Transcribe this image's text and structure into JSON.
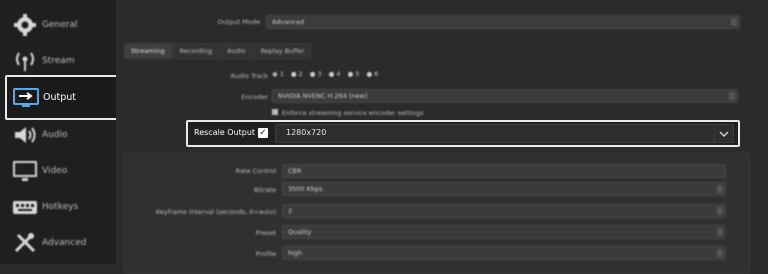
{
  "sidebar": {
    "items": [
      {
        "label": "General",
        "icon": "gear-icon"
      },
      {
        "label": "Stream",
        "icon": "broadcast-icon"
      },
      {
        "label": "Output",
        "icon": "output-monitor-icon"
      },
      {
        "label": "Audio",
        "icon": "speaker-icon"
      },
      {
        "label": "Video",
        "icon": "monitor-icon"
      },
      {
        "label": "Hotkeys",
        "icon": "keyboard-icon"
      },
      {
        "label": "Advanced",
        "icon": "tools-icon"
      }
    ]
  },
  "main": {
    "output_mode": {
      "label": "Output Mode",
      "value": "Advanced"
    },
    "tabs": [
      "Streaming",
      "Recording",
      "Audio",
      "Replay Buffer"
    ],
    "audio_track": {
      "label": "Audio Track",
      "options": [
        "1",
        "2",
        "3",
        "4",
        "5",
        "6"
      ]
    },
    "encoder": {
      "label": "Encoder",
      "value": "NVIDIA NVENC H.264 (new)"
    },
    "enforce": {
      "label": "Enforce streaming service encoder settings"
    },
    "rescale": {
      "label": "Rescale Output",
      "checked": true,
      "check_glyph": "✓",
      "value": "1280x720"
    },
    "rate_control": {
      "label": "Rate Control",
      "value": "CBR"
    },
    "bitrate": {
      "label": "Bitrate",
      "value": "3500 Kbps"
    },
    "keyframe": {
      "label": "Keyframe Interval (seconds, 0=auto)",
      "value": "2"
    },
    "preset": {
      "label": "Preset",
      "value": "Quality"
    },
    "profile": {
      "label": "Profile",
      "value": "high"
    }
  },
  "colors": {
    "highlight_border": "#e8e8e8",
    "sidebar_bg": "#1f1f1f",
    "main_bg": "#2b2b2b"
  }
}
